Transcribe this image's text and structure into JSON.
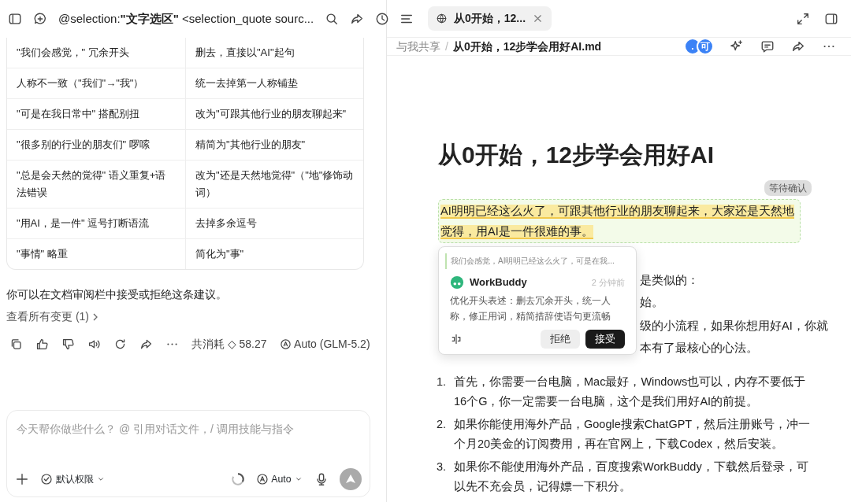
{
  "chat_header": {
    "title": "@selection:**\"文字选区\"** <selection_quote sourc..."
  },
  "table": {
    "rows": [
      [
        "\"我们会感觉，\" 冗余开头",
        "删去，直接以\"AI\"起句"
      ],
      [
        "人称不一致（\"我们\"→\"我\"）",
        "统一去掉第一人称铺垫"
      ],
      [
        "\"可是在我日常中\" 搭配别扭",
        "改为\"可跟其他行业的朋友聊起来\""
      ],
      [
        "\"很多别的行业的朋友们\" 啰嗦",
        "精简为\"其他行业的朋友\""
      ],
      [
        "\"总是会天然的觉得\" 语义重复+语法错误",
        "改为\"还是天然地觉得\"（\"地\"修饰动词）"
      ],
      [
        "\"用AI，是一件\" 逗号打断语流",
        "去掉多余逗号"
      ],
      [
        "\"事情\" 略重",
        "简化为\"事\""
      ]
    ]
  },
  "note": "你可以在文档审阅栏中接受或拒绝这条建议。",
  "changes_link": "查看所有变更 (1)",
  "message_actions": {
    "cost": "共消耗 ◇ 58.27",
    "model": "Auto (GLM-5.2)"
  },
  "composer": {
    "placeholder": "今天帮你做些什么？ @ 引用对话文件，/ 调用技能与指令",
    "permission": "默认权限",
    "model": "Auto"
  },
  "tabs": [
    {
      "label": "从0开始，12...",
      "selected": true
    }
  ],
  "breadcrumb": {
    "parent": "与我共享",
    "separator": "/",
    "current": "从0开始，12步学会用好AI.md"
  },
  "avatars": [
    ".",
    "可"
  ],
  "document": {
    "title": "从0开始，12步学会用好AI",
    "status_badge": "等待确认",
    "highlighted": "AI明明已经这么火了，可跟其他行业的朋友聊起来，大家还是天然地觉得，用AI是一件很难的事。",
    "partial_lines": [
      "是类似的：",
      "始。",
      "级的小流程，如果你想用好AI，你就",
      "本有了最核心的心法。"
    ],
    "list": [
      {
        "number": "1.",
        "text": "首先，你需要一台电脑，Mac最好，Windows也可以，内存不要低于16个G，你一定需要一台电脑，这个是我们用好AI的前提。"
      },
      {
        "number": "2.",
        "text": "如果你能使用海外产品，Google搜索ChatGPT，然后注册账号，冲一个月20美金的订阅费用，再在官网上，下载Codex，然后安装。"
      },
      {
        "number": "3.",
        "text": "如果你不能使用海外产品，百度搜索WorkBuddy，下载然后登录，可以先不充会员，记得嫖一下积分。"
      }
    ]
  },
  "suggestion": {
    "quote": "我们会感觉，AI明明已经这么火了，可是在我...",
    "author": "WorkBuddy",
    "time": "2 分钟前",
    "body": "优化开头表述：删去冗余开头，统一人称，修正用词，精简措辞使语句更流畅",
    "buttons": [
      {
        "label": "拒绝",
        "kind": "secondary"
      },
      {
        "label": "接受",
        "kind": "primary"
      }
    ]
  }
}
